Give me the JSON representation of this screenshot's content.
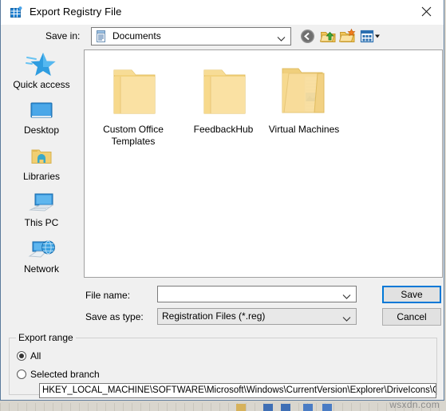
{
  "window": {
    "title": "Export Registry File",
    "title_icon": "registry-grid-icon",
    "close_icon": "close-icon"
  },
  "toolbar": {
    "save_in_label": "Save in:",
    "save_in_value": "Documents",
    "save_in_icon": "documents-folder-icon",
    "buttons": [
      {
        "name": "back-button",
        "icon": "back-arrow-icon"
      },
      {
        "name": "up-one-level-button",
        "icon": "folder-up-arrow-icon"
      },
      {
        "name": "new-folder-button",
        "icon": "new-folder-icon"
      },
      {
        "name": "views-button",
        "icon": "views-grid-icon"
      }
    ]
  },
  "places_bar": {
    "items": [
      {
        "label": "Quick access",
        "icon": "star-icon"
      },
      {
        "label": "Desktop",
        "icon": "monitor-icon"
      },
      {
        "label": "Libraries",
        "icon": "libraries-folder-icon"
      },
      {
        "label": "This PC",
        "icon": "computer-icon"
      },
      {
        "label": "Network",
        "icon": "network-globe-icon"
      }
    ]
  },
  "file_list": {
    "items": [
      {
        "label": "Custom Office Templates",
        "icon": "folder-icon"
      },
      {
        "label": "FeedbackHub",
        "icon": "folder-icon"
      },
      {
        "label": "Virtual Machines",
        "icon": "folder-with-files-icon"
      }
    ]
  },
  "form": {
    "file_name_label": "File name:",
    "file_name_value": "",
    "file_name_placeholder": "",
    "save_as_type_label": "Save as type:",
    "save_as_type_value": "Registration Files (*.reg)",
    "save_label": "Save",
    "cancel_label": "Cancel"
  },
  "export_range": {
    "legend": "Export range",
    "options": [
      {
        "label": "All",
        "selected": true
      },
      {
        "label": "Selected branch",
        "selected": false
      }
    ],
    "branch_path": "HKEY_LOCAL_MACHINE\\SOFTWARE\\Microsoft\\Windows\\CurrentVersion\\Explorer\\DriveIcons\\C\\D"
  },
  "watermark": "wsxdn.com",
  "colors": {
    "accent": "#0078d7",
    "dialog_bg": "#f0f0f0",
    "folder_yellow": "#f7d379",
    "window_border": "#5b7a9c"
  }
}
